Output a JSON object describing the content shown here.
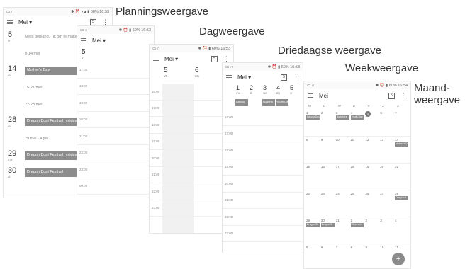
{
  "captions": {
    "planning": "Planningsweergave",
    "day": "Dagweergave",
    "three": "Driedaagse weergave",
    "week": "Weekweergave",
    "month1": "Maand-",
    "month2": "weergave"
  },
  "status": {
    "clock": "16:53",
    "clock2": "16:54",
    "battery": "60%"
  },
  "month_label": "Mei",
  "planning": {
    "rows": [
      {
        "day": "5",
        "wd": "vr",
        "text": "Niets gepland. Tik om te maken."
      },
      {
        "day": "",
        "wd": "",
        "text": "8-14 mei"
      },
      {
        "day": "14",
        "wd": "zo",
        "event": "Mother's Day"
      },
      {
        "day": "",
        "wd": "",
        "text": "15-21 mei"
      },
      {
        "day": "",
        "wd": "",
        "text": "22-28 mei"
      },
      {
        "day": "28",
        "wd": "zo",
        "event": "Dragon Boat Festival holiday"
      },
      {
        "day": "",
        "wd": "",
        "text": "29 mei - 4 jun."
      },
      {
        "day": "29",
        "wd": "ma",
        "event": "Dragon Boat Festival holiday"
      },
      {
        "day": "30",
        "wd": "di",
        "event": "Dragon Boat Festival"
      }
    ]
  },
  "times_a": [
    "17:00",
    "18:00",
    "19:00",
    "20:00",
    "21:00",
    "22:00",
    "23:00",
    "00:00"
  ],
  "day_view": {
    "days": [
      {
        "n": "5",
        "wd": "vr"
      },
      {
        "n": "6",
        "wd": "za"
      }
    ],
    "times": [
      "16:00",
      "17:00",
      "18:00",
      "19:00",
      "20:00",
      "21:00",
      "22:00",
      "23:00"
    ]
  },
  "three_view": {
    "days": [
      {
        "n": "1",
        "wd": "ma"
      },
      {
        "n": "2",
        "wd": "di"
      },
      {
        "n": "3",
        "wd": "wo"
      },
      {
        "n": "4",
        "wd": "do"
      },
      {
        "n": "5",
        "wd": "vr"
      }
    ],
    "events": [
      "Labour",
      "Buddha",
      "Youth Day"
    ],
    "times": [
      "16:00",
      "17:00",
      "18:00",
      "19:00",
      "20:00",
      "21:00",
      "22:00",
      "23:00"
    ]
  },
  "month_view": {
    "headers": [
      "M",
      "D",
      "W",
      "D",
      "V",
      "Z",
      "Z"
    ],
    "weeks": [
      [
        "1",
        "2",
        "3",
        "4",
        "5",
        "6",
        "7"
      ],
      [
        "8",
        "9",
        "10",
        "11",
        "12",
        "13",
        "14"
      ],
      [
        "15",
        "16",
        "17",
        "18",
        "19",
        "20",
        "21"
      ],
      [
        "22",
        "23",
        "24",
        "25",
        "26",
        "27",
        "28"
      ],
      [
        "29",
        "30",
        "31",
        "1",
        "2",
        "3",
        "4"
      ],
      [
        "5",
        "6",
        "7",
        "8",
        "9",
        "10",
        "11"
      ]
    ],
    "events": [
      {
        "w": 0,
        "d": 0,
        "t": "Labour Day"
      },
      {
        "w": 0,
        "d": 2,
        "t": "Buddha's"
      },
      {
        "w": 0,
        "d": 3,
        "t": "Youth Day"
      },
      {
        "w": 1,
        "d": 6,
        "t": "Mother's Day"
      },
      {
        "w": 3,
        "d": 6,
        "t": "Dragon B"
      },
      {
        "w": 4,
        "d": 0,
        "t": "Dragon B"
      },
      {
        "w": 4,
        "d": 1,
        "t": "Dragon B"
      },
      {
        "w": 4,
        "d": 3,
        "t": "Children's"
      }
    ]
  },
  "fab": "+"
}
